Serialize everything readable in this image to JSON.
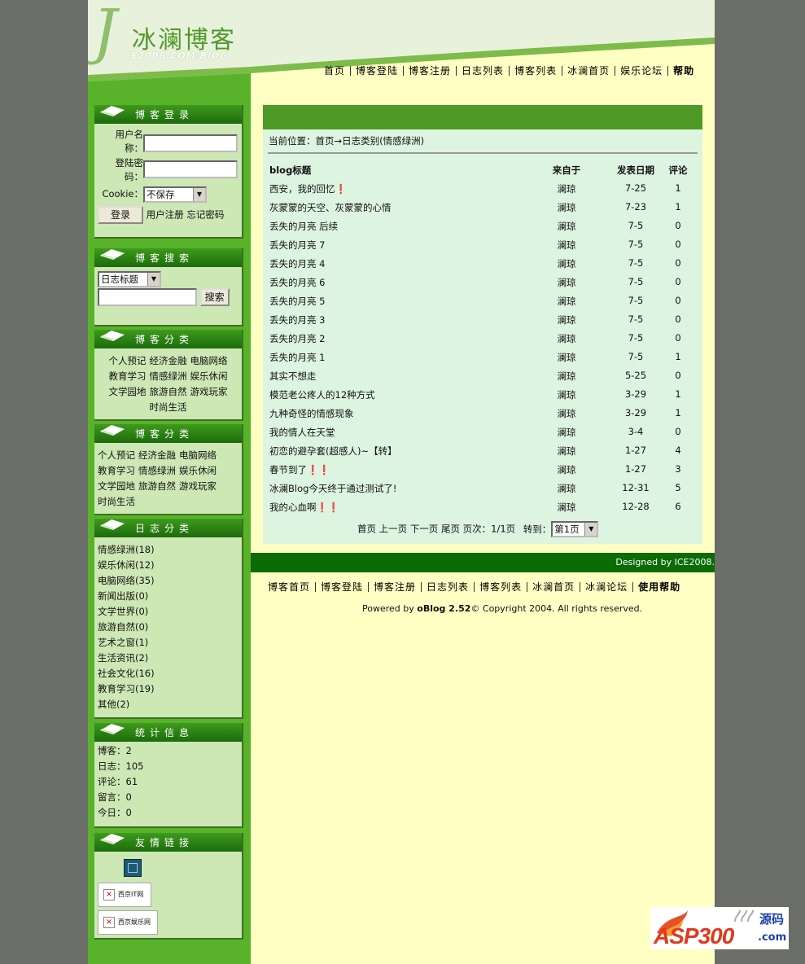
{
  "header": {
    "logo_text": "冰澜博客",
    "logo_sub": "CE2008.COM/BlOG",
    "nav": [
      "首页",
      "博客登陆",
      "博客注册",
      "日志列表",
      "博客列表",
      "冰澜首页",
      "娱乐论坛",
      "帮助"
    ]
  },
  "sidebar": {
    "login": {
      "title": "博客登录",
      "username_label": "用户名称：",
      "password_label": "登陆密码：",
      "cookie_label": "Cookie：",
      "cookie_value": "不保存",
      "login_button": "登录",
      "register_link": "用户注册",
      "forgot_link": "忘记密码"
    },
    "search": {
      "title": "博客搜索",
      "scope_value": "日志标题",
      "search_button": "搜索"
    },
    "categories1": {
      "title": "博客分类",
      "items": [
        "个人预记",
        "经济金融",
        "电脑网络",
        "教育学习",
        "情感绿洲",
        "娱乐休闲",
        "文学园地",
        "旅游自然",
        "游戏玩家",
        "时尚生活"
      ]
    },
    "categories2": {
      "title": "博客分类",
      "items": [
        "个人预记",
        "经济金融",
        "电脑网络",
        "教育学习",
        "情感绿洲",
        "娱乐休闲",
        "文学园地",
        "旅游自然",
        "游戏玩家",
        "时尚生活"
      ]
    },
    "log_categories": {
      "title": "日志分类",
      "items": [
        "情感绿洲(18)",
        "娱乐休闲(12)",
        "电脑网络(35)",
        "新闻出版(0)",
        "文学世界(0)",
        "旅游自然(0)",
        "艺术之窗(1)",
        "生活资讯(2)",
        "社会文化(16)",
        "教育学习(19)",
        "其他(2)"
      ]
    },
    "stats": {
      "title": "统计信息",
      "items": [
        "博客：2",
        "日志：105",
        "评论：61",
        "留言：0",
        "今日：0"
      ]
    },
    "links": {
      "title": "友情链接",
      "items": [
        "西京IT网",
        "西京娱乐网"
      ]
    }
  },
  "main": {
    "breadcrumb": "当前位置：首页→日志类别(情感绿洲)",
    "columns": [
      "blog标题",
      "来自于",
      "发表日期",
      "评论"
    ],
    "rows": [
      [
        "西安，我的回忆❗",
        "澜琼",
        "7-25",
        "1"
      ],
      [
        "灰蒙蒙的天空、灰蒙蒙的心情",
        "澜琼",
        "7-23",
        "1"
      ],
      [
        "丢失的月亮 后续",
        "澜琼",
        "7-5",
        "0"
      ],
      [
        "丢失的月亮 7",
        "澜琼",
        "7-5",
        "0"
      ],
      [
        "丢失的月亮 4",
        "澜琼",
        "7-5",
        "0"
      ],
      [
        "丢失的月亮 6",
        "澜琼",
        "7-5",
        "0"
      ],
      [
        "丢失的月亮 5",
        "澜琼",
        "7-5",
        "0"
      ],
      [
        "丢失的月亮 3",
        "澜琼",
        "7-5",
        "0"
      ],
      [
        "丢失的月亮 2",
        "澜琼",
        "7-5",
        "0"
      ],
      [
        "丢失的月亮 1",
        "澜琼",
        "7-5",
        "1"
      ],
      [
        "其实不想走",
        "澜琼",
        "5-25",
        "0"
      ],
      [
        "模范老公疼人的12种方式",
        "澜琼",
        "3-29",
        "1"
      ],
      [
        "九种奇怪的情感现象",
        "澜琼",
        "3-29",
        "1"
      ],
      [
        "我的情人在天堂",
        "澜琼",
        "3-4",
        "0"
      ],
      [
        "初恋的避孕套(超感人)~【转】",
        "澜琼",
        "1-27",
        "4"
      ],
      [
        "春节到了❗❗",
        "澜琼",
        "1-27",
        "3"
      ],
      [
        "冰澜Blog今天终于通过测试了!",
        "澜琼",
        "12-31",
        "5"
      ],
      [
        "我的心血啊❗❗",
        "澜琼",
        "12-28",
        "6"
      ]
    ],
    "pager": {
      "first": "首页",
      "prev": "上一页",
      "next": "下一页",
      "last": "尾页",
      "info": "页次：1/1页",
      "goto": "转到：",
      "page_value": "第1页"
    }
  },
  "footer": {
    "designed_by": "Designed by ICE2008.",
    "nav": [
      "博客首页",
      "博客登陆",
      "博客注册",
      "日志列表",
      "博客列表",
      "冰澜首页",
      "冰澜论坛",
      "使用帮助"
    ],
    "powered_prefix": "Powered by ",
    "powered_product": "oBlog 2.52",
    "powered_suffix": "© Copyright 2004. All rights reserved."
  },
  "watermark": {
    "text": "ASP300",
    "sub": "源码",
    "domain": ".com"
  },
  "colors": {
    "sidebar": "#58b32a",
    "content": "#ffffc4",
    "panel": "#ddf4e0",
    "header_bar": "#4f9a26",
    "footer_bar": "#0b6b06"
  }
}
